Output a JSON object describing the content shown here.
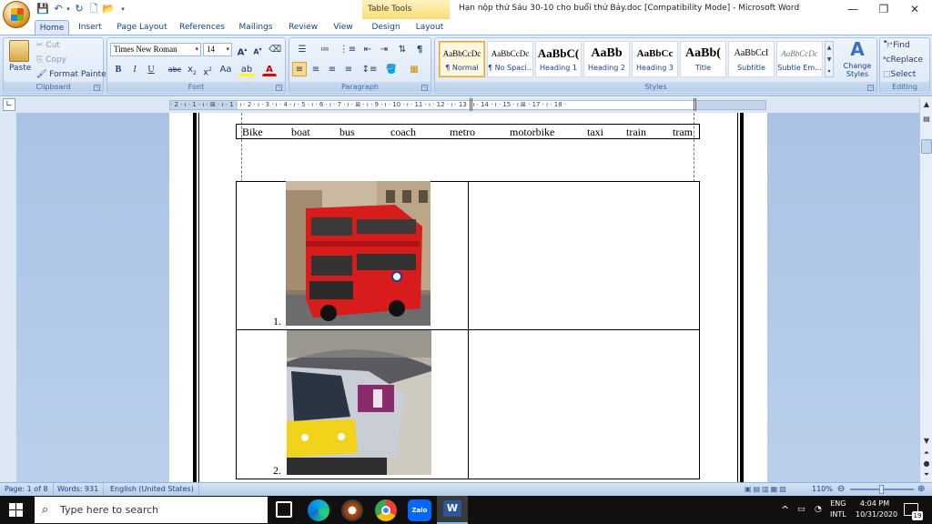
{
  "title_bar": {
    "table_tools": "Table Tools",
    "document_title": "Hạn nộp thứ Sáu 30-10 cho buổi thứ Bảy.doc [Compatibility Mode] - Microsoft Word"
  },
  "tabs": [
    "Home",
    "Insert",
    "Page Layout",
    "References",
    "Mailings",
    "Review",
    "View",
    "Design",
    "Layout"
  ],
  "clipboard": {
    "paste": "Paste",
    "cut": "Cut",
    "copy": "Copy",
    "format_painter": "Format Painter",
    "label": "Clipboard"
  },
  "font": {
    "name": "Times New Roman",
    "size": "14",
    "label": "Font"
  },
  "paragraph": {
    "label": "Paragraph"
  },
  "styles": {
    "items": [
      {
        "sample": "AaBbCcDc",
        "name": "¶ Normal"
      },
      {
        "sample": "AaBbCcDc",
        "name": "¶ No Spaci..."
      },
      {
        "sample": "AaBbC(",
        "name": "Heading 1"
      },
      {
        "sample": "AaBb",
        "name": "Heading 2"
      },
      {
        "sample": "AaBbCc",
        "name": "Heading 3"
      },
      {
        "sample": "AaBb(",
        "name": "Title"
      },
      {
        "sample": "AaBbCcI",
        "name": "Subtitle"
      },
      {
        "sample": "AaBbCcDc",
        "name": "Subtle Em..."
      }
    ],
    "change_styles": "Change Styles",
    "label": "Styles"
  },
  "editing": {
    "find": "Find",
    "replace": "Replace",
    "select": "Select",
    "label": "Editing"
  },
  "ruler": {
    "numbers": "· 2 · ı · 1 · ı · ⊠ · ı · 1 · ı · 2 · ı · 3 · ı · 4 · ı · 5 · ı · 6 · ı · 7 · ı · ⊠ · ı · 9 · ı · 10 · ı · 11 · ı · 12 · ı · 13 · ı · 14 · ı · 15 · ı ⊠ · 17 · ı · 18 ·"
  },
  "document": {
    "vocab": [
      "Bike",
      "boat",
      "bus",
      "coach",
      "metro",
      "motorbike",
      "taxi",
      "train",
      "tram"
    ],
    "item1_number": "1.",
    "item2_number": "2."
  },
  "status_bar": {
    "page": "Page: 1 of 8",
    "words": "Words: 931",
    "language": "English (United States)",
    "zoom": "110%"
  },
  "taskbar": {
    "search_placeholder": "Type here to search",
    "lang_top": "ENG",
    "lang_bottom": "INTL",
    "time": "4:04 PM",
    "date": "10/31/2020",
    "notif_count": "19"
  }
}
